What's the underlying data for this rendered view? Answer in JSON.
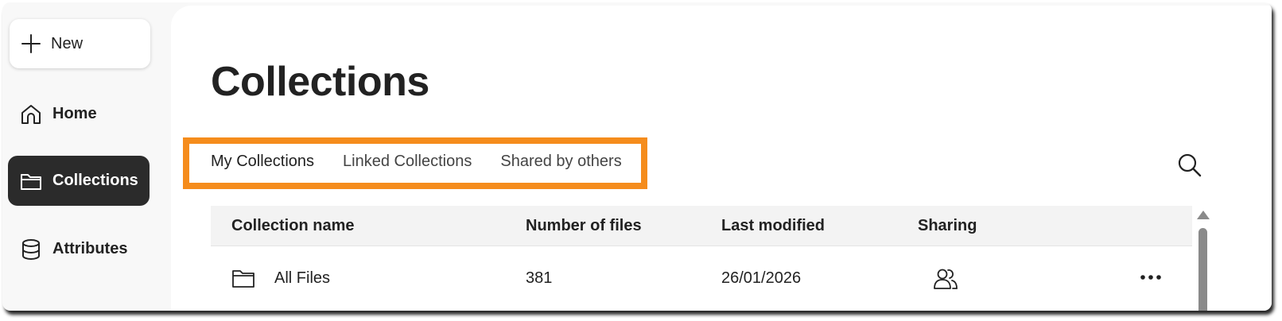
{
  "sidebar": {
    "new_label": "New",
    "items": [
      {
        "label": "Home",
        "icon": "home-icon"
      },
      {
        "label": "Collections",
        "icon": "folder-icon",
        "active": true
      },
      {
        "label": "Attributes",
        "icon": "database-icon"
      }
    ]
  },
  "main": {
    "title": "Collections",
    "tabs": [
      {
        "label": "My Collections",
        "active": true
      },
      {
        "label": "Linked Collections"
      },
      {
        "label": "Shared by others"
      }
    ],
    "search_icon": "search-icon",
    "highlight_color": "#f58c1c"
  },
  "table": {
    "columns": [
      "Collection name",
      "Number of files",
      "Last modified",
      "Sharing"
    ],
    "rows": [
      {
        "name": "All Files",
        "files": "381",
        "modified": "26/01/2026",
        "sharing_icon": "users-icon",
        "actions_icon": "more-icon"
      }
    ]
  },
  "colors": {
    "active_nav_bg": "#2b2b2b",
    "accent": "#f58c1c"
  }
}
